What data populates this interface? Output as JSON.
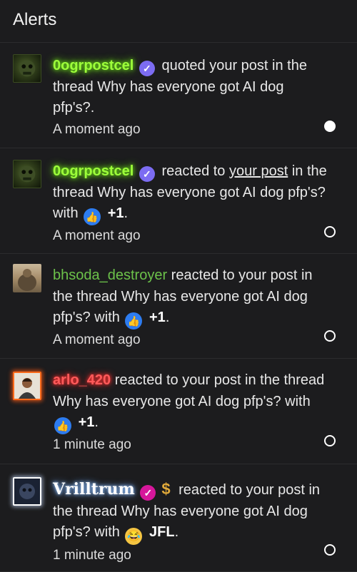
{
  "header": {
    "title": "Alerts"
  },
  "alerts": [
    {
      "username": "0ogrpostcel",
      "verified_icon": "check-badge-icon",
      "text_before_link": " quoted your post in the thread Why has everyone got AI dog pfp's?.",
      "time": "A moment ago",
      "status": "unread"
    },
    {
      "username": "0ogrpostcel",
      "verified_icon": "check-badge-icon",
      "text_before_link": " reacted to ",
      "link_text": "your post",
      "text_after_link": " in the thread Why has everyone got AI dog pfp's? with ",
      "reaction_icon": "thumbs-up-icon",
      "reaction_label": "+1",
      "text_end": ".",
      "time": "A moment ago",
      "status": "read"
    },
    {
      "username": "bhsoda_destroyer",
      "text_before_link": " reacted to your post in the thread Why has everyone got AI dog pfp's? with ",
      "reaction_icon": "thumbs-up-icon",
      "reaction_label": "+1",
      "text_end": ".",
      "time": "A moment ago",
      "status": "read"
    },
    {
      "username": "arlo_420",
      "text_before_link": " reacted to your post in the thread Why has everyone got AI dog pfp's? with ",
      "reaction_icon": "thumbs-up-icon",
      "reaction_label": "+1",
      "text_end": ".",
      "time": "1 minute ago",
      "status": "read"
    },
    {
      "username": "Vrilltrum",
      "verified_icon": "check-badge-icon",
      "extra_icon": "dollar-icon",
      "extra_glyph": "$",
      "text_before_link": " reacted to your post in the thread Why has everyone got AI dog pfp's? with ",
      "reaction_icon": "tears-of-joy-emoji-icon",
      "reaction_label": "JFL",
      "text_end": ".",
      "time": "1 minute ago",
      "status": "read"
    }
  ],
  "colors": {
    "background": "#1c1c1e",
    "username_green": "#9dff3a",
    "username_plain": "#6cc24a",
    "username_red": "#ff5a5a",
    "badge_purple": "#7c6cf2",
    "badge_magenta": "#d6179b",
    "reaction_blue": "#2d7cf0"
  }
}
